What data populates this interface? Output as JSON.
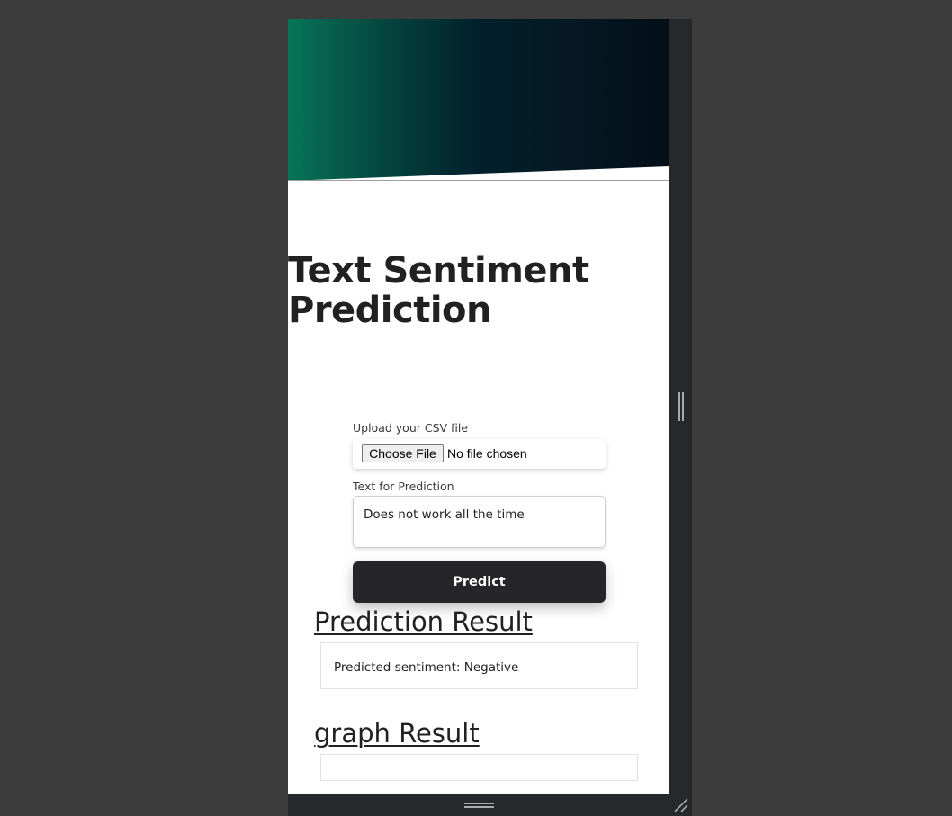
{
  "title": "Text Sentiment Prediction",
  "upload": {
    "label": "Upload your CSV file",
    "button_label": "Choose File",
    "status": "No file chosen"
  },
  "text_input": {
    "label": "Text for Prediction",
    "value": "Does not work all the time"
  },
  "predict_label": "Predict",
  "prediction_result": {
    "heading": "Prediction Result",
    "text": "Predicted sentiment: Negative"
  },
  "graph_result": {
    "heading": "graph Result"
  },
  "colors": {
    "hero_start": "#077558",
    "hero_end": "#040f17",
    "button_bg": "#262628"
  }
}
